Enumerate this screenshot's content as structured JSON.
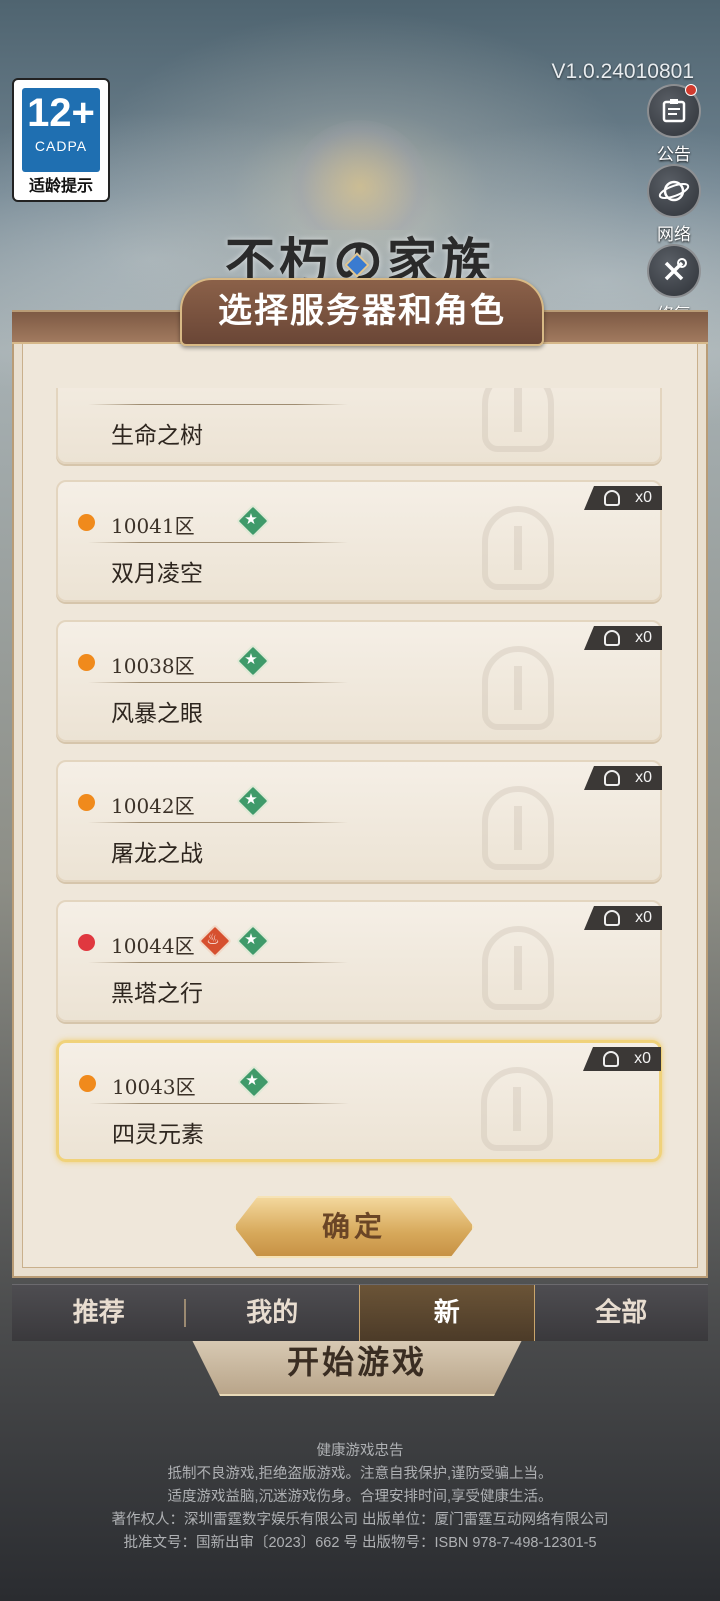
{
  "age_rating": {
    "age": "12+",
    "org": "CADPA",
    "tip": "适龄提示"
  },
  "version": "V1.0.24010801",
  "side_buttons": [
    {
      "label": "公告",
      "icon": "notice-board-icon"
    },
    {
      "label": "网络",
      "icon": "planet-network-icon"
    },
    {
      "label": "修复",
      "icon": "wrench-repair-icon"
    }
  ],
  "logo_text": "不朽の家族",
  "panel_title": "选择服务器和角色",
  "servers": [
    {
      "zone": "",
      "name": "生命之树",
      "status": "",
      "badges": [],
      "roles": ""
    },
    {
      "zone": "10041区",
      "name": "双月凌空",
      "status": "#f08a1c",
      "badges": [
        "new"
      ],
      "roles": "x0"
    },
    {
      "zone": "10038区",
      "name": "风暴之眼",
      "status": "#f08a1c",
      "badges": [
        "new"
      ],
      "roles": "x0"
    },
    {
      "zone": "10042区",
      "name": "屠龙之战",
      "status": "#f08a1c",
      "badges": [
        "new"
      ],
      "roles": "x0"
    },
    {
      "zone": "10044区",
      "name": "黑塔之行",
      "status": "#e0383f",
      "badges": [
        "hot",
        "new"
      ],
      "roles": "x0"
    },
    {
      "zone": "10043区",
      "name": "四灵元素",
      "status": "#f08a1c",
      "badges": [
        "new"
      ],
      "roles": "x0",
      "selected": true
    }
  ],
  "confirm_label": "确定",
  "tabs": [
    {
      "label": "推荐"
    },
    {
      "label": "我的"
    },
    {
      "label": "新",
      "active": true
    },
    {
      "label": "全部"
    }
  ],
  "start_label": "开始游戏",
  "footer_lines": [
    "健康游戏忠告",
    "抵制不良游戏,拒绝盗版游戏。注意自我保护,谨防受骗上当。",
    "适度游戏益脑,沉迷游戏伤身。合理安排时间,享受健康生活。",
    "著作权人：深圳雷霆数字娱乐有限公司 出版单位：厦门雷霆互动网络有限公司",
    "批准文号：国新出审〔2023〕662 号 出版物号：ISBN 978-7-498-12301-5"
  ]
}
